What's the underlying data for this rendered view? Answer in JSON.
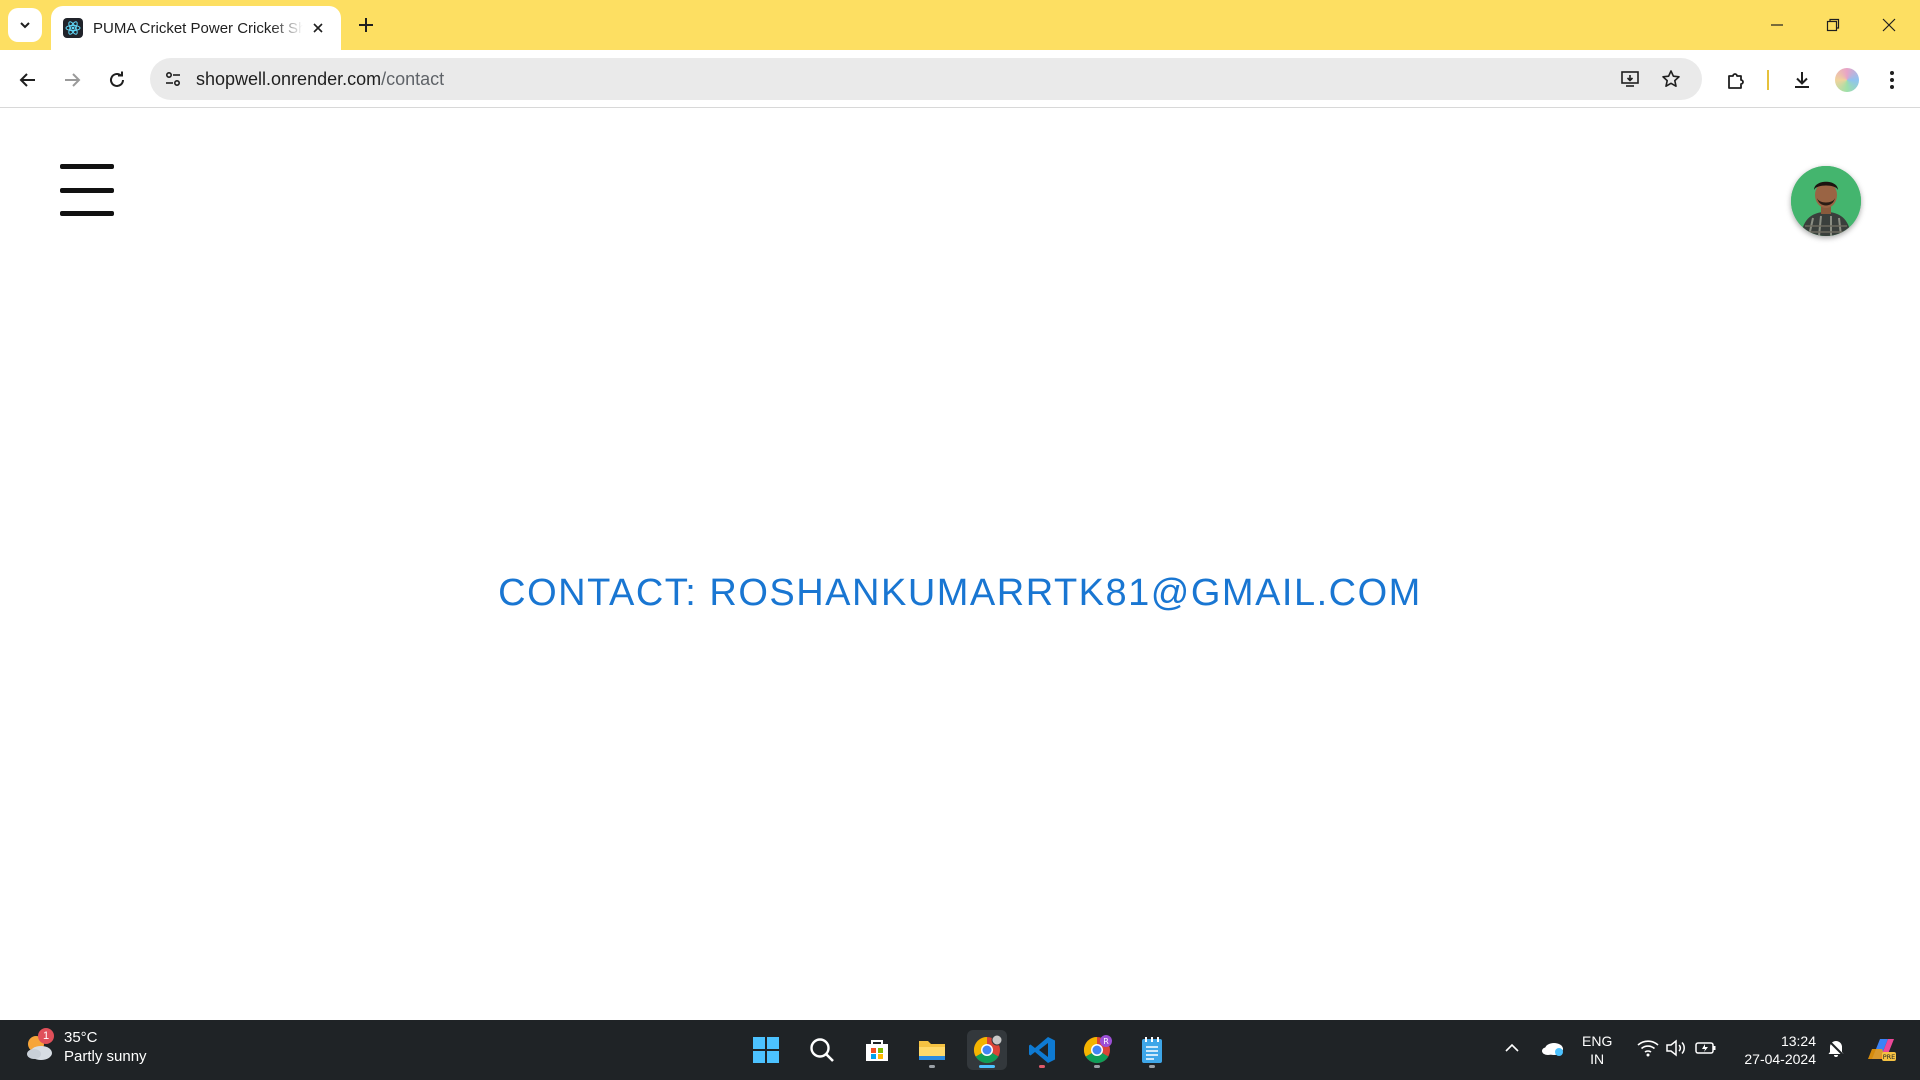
{
  "browser": {
    "tab_title": "PUMA Cricket Power Cricket Shoes",
    "url_domain": "shopwell.onrender.com",
    "url_path": "/contact"
  },
  "page": {
    "contact_text": "CONTACT: ROSHANKUMARRTK81@GMAIL.COM",
    "accent_color": "#1976d2"
  },
  "taskbar": {
    "weather_temp": "35°C",
    "weather_desc": "Partly sunny",
    "weather_badge": "1",
    "lang_top": "ENG",
    "lang_bottom": "IN",
    "time": "13:24",
    "date": "27-04-2024",
    "apps": [
      "start-icon",
      "search-icon",
      "store-icon",
      "file-explorer-icon",
      "chrome-icon",
      "vscode-icon",
      "chrome-profile-icon",
      "notepad-icon"
    ]
  },
  "colors": {
    "tabstrip": "#fddf62",
    "taskbar": "#1f2326"
  }
}
